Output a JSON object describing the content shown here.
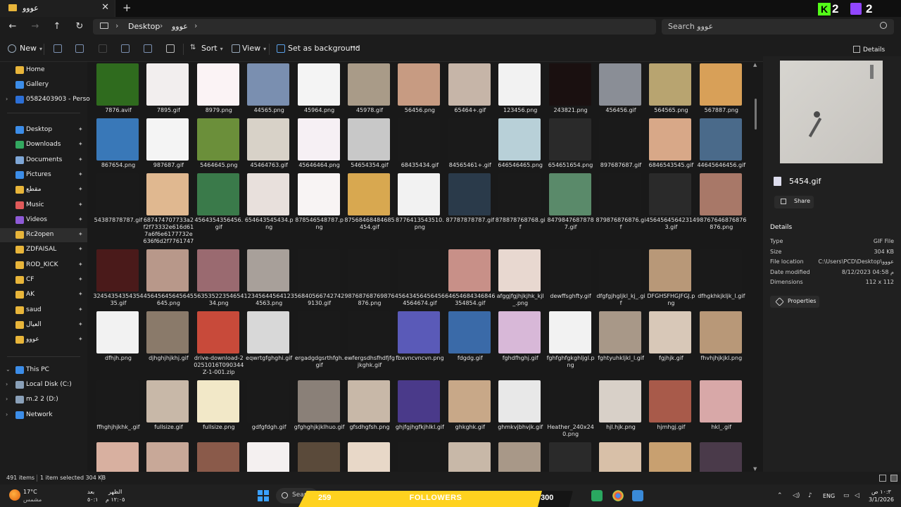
{
  "window": {
    "tab_title": "عووو",
    "tab_close": "✕",
    "new_tab": "+"
  },
  "overlay": {
    "kick_logo": "K",
    "kick_viewers": "2",
    "twitch_viewers": "2",
    "followers_current": "259",
    "followers_label": "FOLLOWERS",
    "followers_goal": "300"
  },
  "address": {
    "back": "←",
    "forward": "→",
    "up": "↑",
    "refresh": "↻",
    "crumbs": [
      "Desktop",
      "عووو"
    ],
    "sep": "›",
    "search_placeholder": "Search عووو"
  },
  "commands": {
    "new": "New",
    "sort": "Sort",
    "view": "View",
    "set_background": "Set as background",
    "more": "···",
    "details": "Details"
  },
  "nav": {
    "quick": [
      {
        "label": "Home",
        "color": "#e8b53a"
      },
      {
        "label": "Gallery",
        "color": "#3c8de8"
      },
      {
        "label": "0582403903 - Personal",
        "color": "#2c6fd6"
      }
    ],
    "pinned": [
      {
        "label": "Desktop",
        "color": "#3c8de8",
        "pin": "📌"
      },
      {
        "label": "Downloads",
        "color": "#33a860",
        "pin": "📌"
      },
      {
        "label": "Documents",
        "color": "#7ea6d6",
        "pin": "📌"
      },
      {
        "label": "Pictures",
        "color": "#3c8de8",
        "pin": "📌"
      },
      {
        "label": "مقطع",
        "color": "#e8b53a",
        "pin": "📌"
      },
      {
        "label": "Music",
        "color": "#e05a5a",
        "pin": "📌"
      },
      {
        "label": "Videos",
        "color": "#8e5ad6",
        "pin": "📌"
      },
      {
        "label": "Rc2open",
        "color": "#e8b53a",
        "pin": "📌"
      },
      {
        "label": "ZDFAISAL",
        "color": "#e8b53a",
        "pin": "📌"
      },
      {
        "label": "ROD_KICK",
        "color": "#e8b53a",
        "pin": "📌"
      },
      {
        "label": "CF",
        "color": "#e8b53a",
        "pin": "📌"
      },
      {
        "label": "AK",
        "color": "#e8b53a",
        "pin": "📌"
      },
      {
        "label": "saud",
        "color": "#e8b53a",
        "pin": "📌"
      },
      {
        "label": "العيال",
        "color": "#e8b53a",
        "pin": "📌"
      },
      {
        "label": "عووو",
        "color": "#e8b53a",
        "pin": "📌"
      }
    ],
    "devices": [
      {
        "label": "This PC",
        "color": "#3c8de8",
        "exp": "⌄"
      },
      {
        "label": "Local Disk (C:)",
        "color": "#8aa0b8",
        "exp": "›"
      },
      {
        "label": "m.2 2 (D:)",
        "color": "#8aa0b8",
        "exp": "›"
      },
      {
        "label": "Network",
        "color": "#3c8de8",
        "exp": "›"
      }
    ]
  },
  "files": [
    {
      "name": "7876.avif",
      "bg": "#2f6b1e"
    },
    {
      "name": "7895.gif",
      "bg": "#f2eeee"
    },
    {
      "name": "8979.png",
      "bg": "#fbf3f5"
    },
    {
      "name": "44565.png",
      "bg": "#7a8fb0"
    },
    {
      "name": "45964.png",
      "bg": "#f4f4f4"
    },
    {
      "name": "45978.gif",
      "bg": "#a99b88"
    },
    {
      "name": "56456.png",
      "bg": "#c79b82"
    },
    {
      "name": "65464+.gif",
      "bg": "#c6b5a8"
    },
    {
      "name": "123456.png",
      "bg": "#f2f2f2"
    },
    {
      "name": "243821.png",
      "bg": "#1a1010"
    },
    {
      "name": "456456.gif",
      "bg": "#8a8e96"
    },
    {
      "name": "564565.png",
      "bg": "#b8a470"
    },
    {
      "name": "567887.png",
      "bg": "#d8a058"
    },
    {
      "name": "867654.png",
      "bg": "#3978b8"
    },
    {
      "name": "987687.gif",
      "bg": "#f4f4f4"
    },
    {
      "name": "5464645.png",
      "bg": "#6b8f3a"
    },
    {
      "name": "45464763.gif",
      "bg": "#d8d2c8"
    },
    {
      "name": "45646464.png",
      "bg": "#f6f0f4"
    },
    {
      "name": "54654354.gif",
      "bg": "#c8c8c8"
    },
    {
      "name": "68435434.gif",
      "bg": "#1a1a1a"
    },
    {
      "name": "84565461+.gif",
      "bg": "#1a1a1a"
    },
    {
      "name": "646546465.png",
      "bg": "#b8d0d8"
    },
    {
      "name": "654651654.png",
      "bg": "#2a2a2a"
    },
    {
      "name": "897687687.gif",
      "bg": "#1a1a1a"
    },
    {
      "name": "6846543545.gif",
      "bg": "#d8a888"
    },
    {
      "name": "44645646456.gif",
      "bg": "#4a6a8a"
    },
    {
      "name": "54387878787.gif",
      "bg": "#1a1a1a"
    },
    {
      "name": "687474707733a2f2f73332e616d617a6f6e6177732e636f6d2f7761747470646173686f6f64",
      "bg": "#e0b890"
    },
    {
      "name": "4564354356456.gif",
      "bg": "#3a7a4a"
    },
    {
      "name": "654643545434.png",
      "bg": "#e8e0dc"
    },
    {
      "name": "878546548787.png",
      "bg": "#f8f4f4"
    },
    {
      "name": "87568468484685454.gif",
      "bg": "#d8a850"
    },
    {
      "name": "8776413543510.png",
      "bg": "#f2f2f2"
    },
    {
      "name": "87787878787.gif",
      "bg": "#2a3a4a"
    },
    {
      "name": "878878768768.gif",
      "bg": "#1a1a1a"
    },
    {
      "name": "84798476878787.gif",
      "bg": "#5a8a6a"
    },
    {
      "name": "879876876876.gif",
      "bg": "#1a1a1a"
    },
    {
      "name": "456456456423143.gif",
      "bg": "#2a2a2a"
    },
    {
      "name": "98767646876876876.png",
      "bg": "#a87868"
    },
    {
      "name": "3245435435435435.gif",
      "bg": "#4a1a1a"
    },
    {
      "name": "45645645645645645.png",
      "bg": "#b8988a"
    },
    {
      "name": "5635352235465434.png",
      "bg": "#9a6a70"
    },
    {
      "name": "123456445641234563.png",
      "bg": "#a8a09a"
    },
    {
      "name": "568405667427429130.gif",
      "bg": "#1a1a1a"
    },
    {
      "name": "98768768769876876.png",
      "bg": "#1a1a1a"
    },
    {
      "name": "456434564564564564674.gif",
      "bg": "#1a1a1a"
    },
    {
      "name": "64654684346846354854.gif",
      "bg": "#c89088"
    },
    {
      "name": "afggjfgjhjkjhk_kjl_.png",
      "bg": "#e8d8d0"
    },
    {
      "name": "dewffsghfty.gif",
      "bg": "#1a1a1a"
    },
    {
      "name": "dfgfgjhgljkl_kj_.gif",
      "bg": "#1a1a1a"
    },
    {
      "name": "DFGHSFHGJFGJ.png",
      "bg": "#b89878"
    },
    {
      "name": "dfhgkhkjkljk_l.gif",
      "bg": "#1a1a1a"
    },
    {
      "name": "dfhjh.png",
      "bg": "#f2f2f2"
    },
    {
      "name": "djhghjhjkhj.gif",
      "bg": "#8a7a6a"
    },
    {
      "name": "drive-download-20251016T090344Z-1-001.zip",
      "bg": "#c84a3a"
    },
    {
      "name": "eqwrtgfghghi.gif",
      "bg": "#d8d8d8"
    },
    {
      "name": "ergadgdgsrthfgh.gif",
      "bg": "#1a1a1a"
    },
    {
      "name": "ewfergsdhsfhdfjfgjkghk.gif",
      "bg": "#1a1a1a"
    },
    {
      "name": "fbxvncvncvn.png",
      "bg": "#5a5ab8"
    },
    {
      "name": "fdgdg.gif",
      "bg": "#3a6aa8"
    },
    {
      "name": "fghdfhghj.gif",
      "bg": "#d8b8d8"
    },
    {
      "name": "fghfghfgkghljgl.png",
      "bg": "#f2f2f2"
    },
    {
      "name": "fghtyuhkljkl_l.gif",
      "bg": "#a89888"
    },
    {
      "name": "fgjhjk.gif",
      "bg": "#d8c8b8"
    },
    {
      "name": "fhvhjhjkjkl.png",
      "bg": "#b89878"
    },
    {
      "name": "ffhghjhjkhk_.gif",
      "bg": "#1a1a1a"
    },
    {
      "name": "fullsize.gif",
      "bg": "#c8b8a8"
    },
    {
      "name": "fullsize.png",
      "bg": "#f2e8c8"
    },
    {
      "name": "gdfgfdgh.gif",
      "bg": "#1a1a1a"
    },
    {
      "name": "gfghghjkjklhuo.gif",
      "bg": "#8a8078"
    },
    {
      "name": "gfsdhgfsh.png",
      "bg": "#c8b8a8"
    },
    {
      "name": "ghjfgjhgfkjhlkl.gif",
      "bg": "#4a3a8a"
    },
    {
      "name": "ghkghk.gif",
      "bg": "#c8a888"
    },
    {
      "name": "ghmkvjbhvjk.gif",
      "bg": "#e8e8e8"
    },
    {
      "name": "Heather_240x240.png",
      "bg": "#1a1a1a"
    },
    {
      "name": "hjl.hjk.png",
      "bg": "#d8d0c8"
    },
    {
      "name": "hjmhgj.gif",
      "bg": "#a85a4a"
    },
    {
      "name": "hkl_.gif",
      "bg": "#d8a8a8"
    },
    {
      "name": "",
      "bg": "#d8b0a0"
    },
    {
      "name": "",
      "bg": "#c8a898"
    },
    {
      "name": "",
      "bg": "#8a5a4a"
    },
    {
      "name": "",
      "bg": "#f4f0f0"
    },
    {
      "name": "",
      "bg": "#5a4a3a"
    },
    {
      "name": "",
      "bg": "#e8d8c8"
    },
    {
      "name": "",
      "bg": "#1a1a1a"
    },
    {
      "name": "",
      "bg": "#c8b8a8"
    },
    {
      "name": "",
      "bg": "#a89888"
    },
    {
      "name": "",
      "bg": "#2a2a2a"
    },
    {
      "name": "",
      "bg": "#d8c0a8"
    },
    {
      "name": "",
      "bg": "#c8a070"
    },
    {
      "name": "",
      "bg": "#4a3a4a"
    }
  ],
  "details": {
    "file_name": "5454.gif",
    "share": "Share",
    "heading": "Details",
    "rows": [
      {
        "k": "Type",
        "v": "GIF File"
      },
      {
        "k": "Size",
        "v": "304 KB"
      },
      {
        "k": "File location",
        "v": "C:\\Users\\PCD\\Desktop\\عووو"
      },
      {
        "k": "Date modified",
        "v": "8/12/2023 04:58 م"
      },
      {
        "k": "Dimensions",
        "v": "112 x 112"
      }
    ],
    "properties": "Properties"
  },
  "status": {
    "count": "491 items",
    "selection": "1 item selected  304 KB"
  },
  "taskbar": {
    "temp": "17°C",
    "weather": "مشمس",
    "prayer_label": "الظهر",
    "prayer_time": "١٢:٠٥ م",
    "after_label": "بعد",
    "after_time": "٥٠:١",
    "search": "Search",
    "lang": "ENG",
    "time": "١٠:٣ ص",
    "date": "3/1/2026"
  }
}
